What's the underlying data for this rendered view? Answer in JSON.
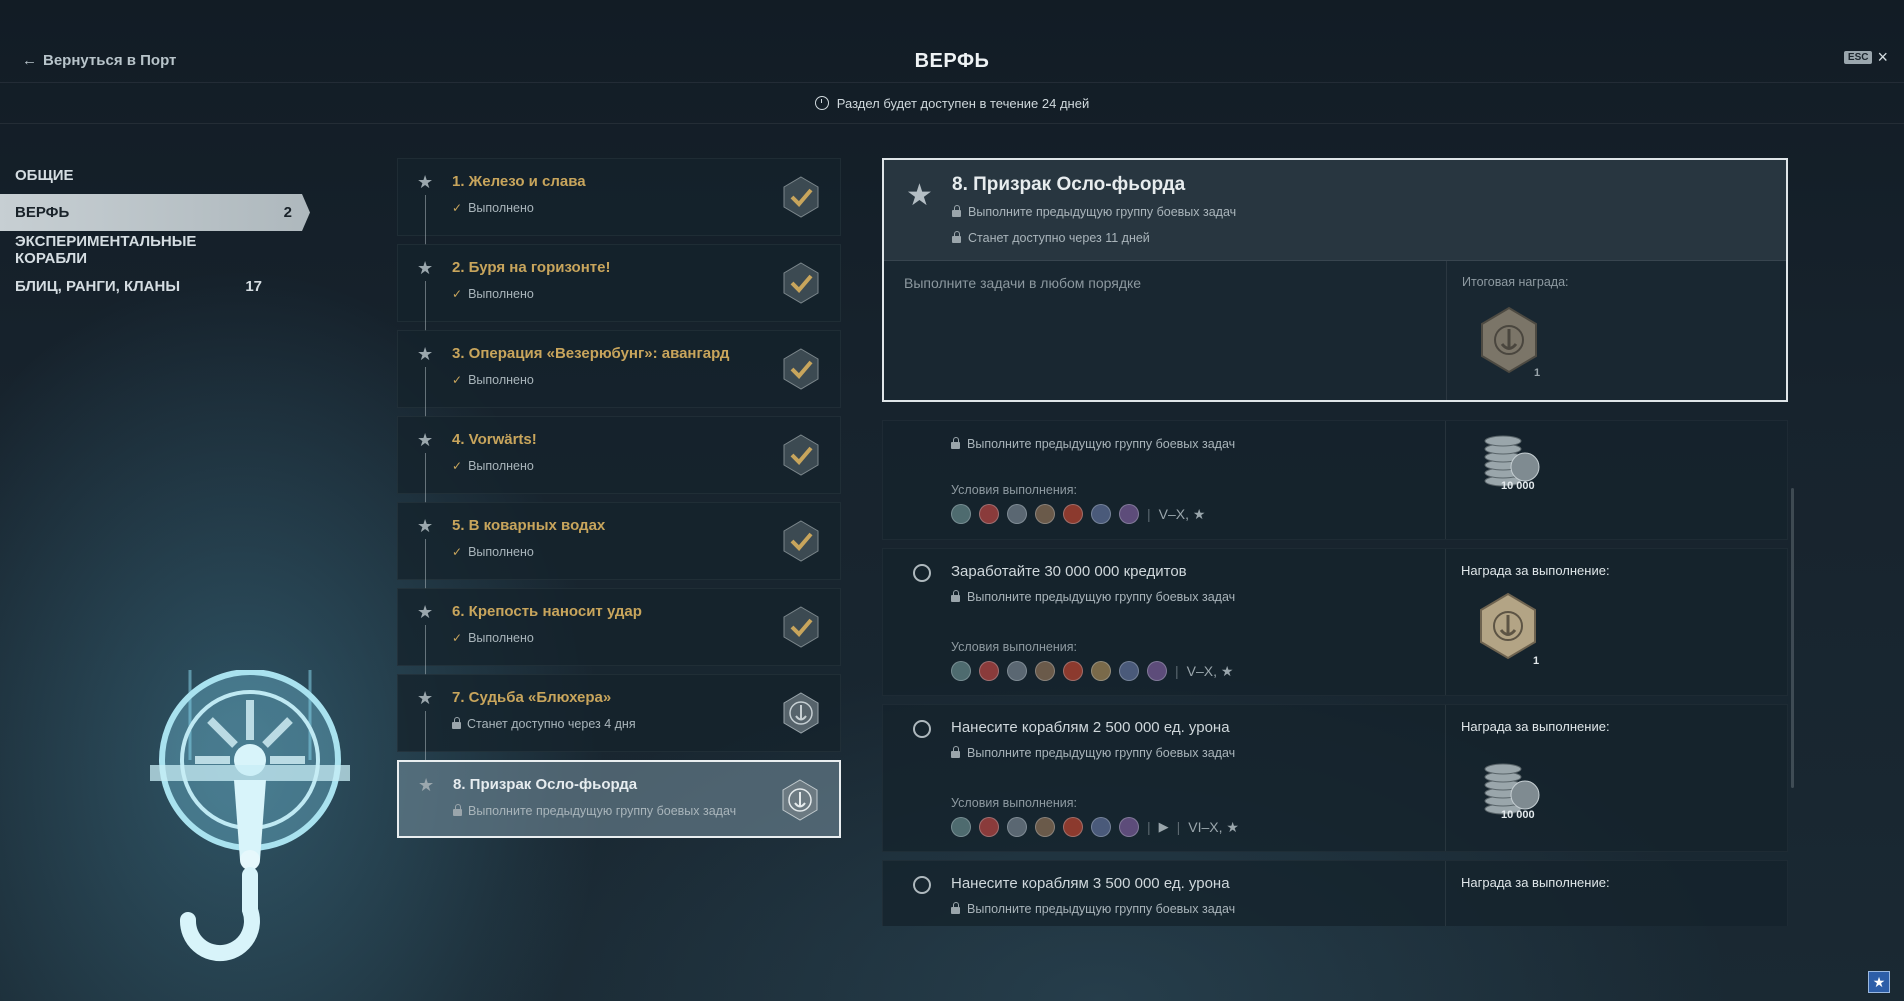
{
  "header": {
    "back_label": "Вернуться в Порт",
    "title": "ВЕРФЬ",
    "esc_key": "ESC",
    "availability": "Раздел будет доступен в течение 24 дней"
  },
  "sidebar": {
    "items": [
      {
        "label": "ОБЩИЕ",
        "count": ""
      },
      {
        "label": "ВЕРФЬ",
        "count": "2"
      },
      {
        "label": "ЭКСПЕРИМЕНТАЛЬНЫЕ КОРАБЛИ",
        "count": ""
      },
      {
        "label": "БЛИЦ, РАНГИ, КЛАНЫ",
        "count": "17"
      }
    ],
    "active_index": 1
  },
  "tasks": [
    {
      "name": "1. Железо и слава",
      "status": "Выполнено",
      "state": "done"
    },
    {
      "name": "2. Буря на горизонте!",
      "status": "Выполнено",
      "state": "done"
    },
    {
      "name": "3. Операция «Везерюбунг»: авангард",
      "status": "Выполнено",
      "state": "done"
    },
    {
      "name": "4. Vorwärts!",
      "status": "Выполнено",
      "state": "done"
    },
    {
      "name": "5. В коварных водах",
      "status": "Выполнено",
      "state": "done"
    },
    {
      "name": "6. Крепость наносит удар",
      "status": "Выполнено",
      "state": "done"
    },
    {
      "name": "7. Судьба «Блюхера»",
      "status": "Станет доступно через 4 дня",
      "state": "locked"
    },
    {
      "name": "8. Призрак Осло-фьорда",
      "status": "Выполните предыдущую группу боевых задач",
      "state": "selected"
    }
  ],
  "detail": {
    "title": "8. Призрак Осло-фьорда",
    "req1": "Выполните предыдущую группу боевых задач",
    "req2": "Станет доступно через 11 дней",
    "hint": "Выполните задачи в любом порядке",
    "final_reward_label": "Итоговая награда:",
    "final_reward_count": "1"
  },
  "subtasks": [
    {
      "name": "",
      "req": "Выполните предыдущую группу боевых задач",
      "cond_label": "Условия выполнения:",
      "tiers": "V–X, ★",
      "reward_label": "",
      "reward_amount": "10 000"
    },
    {
      "name": "Заработайте 30 000 000 кредитов",
      "req": "Выполните предыдущую группу боевых задач",
      "cond_label": "Условия выполнения:",
      "tiers": "V–X, ★",
      "reward_label": "Награда за выполнение:",
      "reward_amount": "1"
    },
    {
      "name": "Нанесите кораблям 2 500 000 ед. урона",
      "req": "Выполните предыдущую группу боевых задач",
      "cond_label": "Условия выполнения:",
      "tiers": "VI–X, ★",
      "reward_label": "Награда за выполнение:",
      "reward_amount": "10 000"
    },
    {
      "name": "Нанесите кораблям 3 500 000 ед. урона",
      "req": "Выполните предыдущую группу боевых задач",
      "cond_label": "",
      "tiers": "",
      "reward_label": "Награда за выполнение:",
      "reward_amount": ""
    }
  ],
  "icons": {
    "back": "arrow-left-icon",
    "clock": "clock-icon",
    "star": "star-icon",
    "check": "checkmark-icon",
    "lock": "lock-icon",
    "close": "close-icon",
    "hook": "crane-hook-icon"
  },
  "colors": {
    "accent_gold": "#c8a55c",
    "active_tab": "#c7cfd3",
    "pin_blue": "#2d5ea8"
  }
}
